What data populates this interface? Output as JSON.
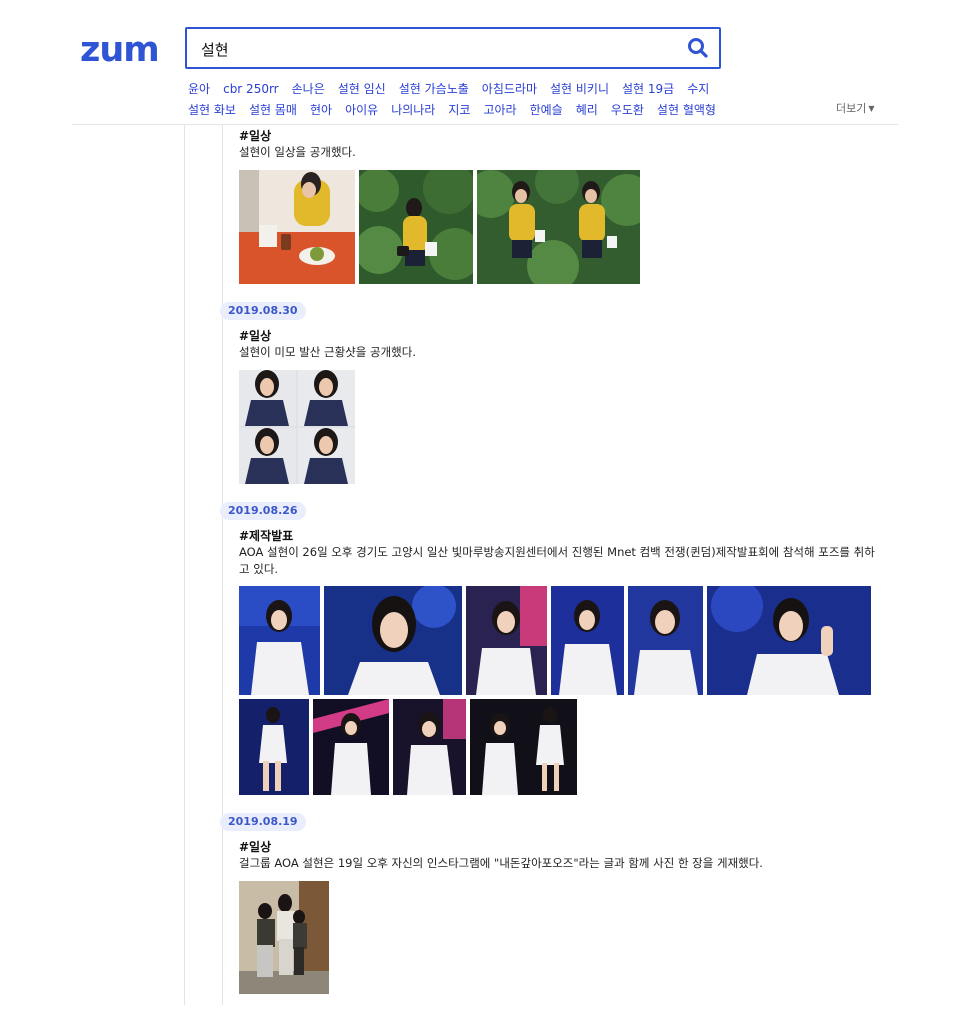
{
  "header": {
    "logo_text": "ZUM",
    "search": {
      "value": "설현"
    },
    "related_row1": [
      "윤아",
      "cbr 250rr",
      "손나은",
      "설현 임신",
      "설현 가슴노출",
      "아침드라마",
      "설현 비키니",
      "설현 19금",
      "수지"
    ],
    "related_row2": [
      "설현 화보",
      "설현 몸매",
      "현아",
      "아이유",
      "나의나라",
      "지코",
      "고아라",
      "한예슬",
      "혜리",
      "우도환",
      "설현 혈액형"
    ],
    "more_label": "더보기"
  },
  "colors": {
    "brand": "#2f55d4",
    "link": "#2a3fd4",
    "badge_bg": "#eaedfb",
    "badge_text": "#3b57c9"
  },
  "timeline": [
    {
      "date": "",
      "tag": "#일상",
      "text": "설현이 일상을 공개했다.",
      "photos": 3
    },
    {
      "date": "2019.08.30",
      "tag": "#일상",
      "text": "설현이 미모 발산 근황샷을 공개했다.",
      "photos": 1
    },
    {
      "date": "2019.08.26",
      "tag": "#제작발표",
      "text": "AOA 설현이 26일 오후 경기도 고양시 일산 빛마루방송지원센터에서 진행된 Mnet 컴백 전쟁(퀸덤)제작발표회에 참석해 포즈를 취하고 있다.",
      "photos": 10
    },
    {
      "date": "2019.08.19",
      "tag": "#일상",
      "text": "걸그룹 AOA 설현은 19일 오후 자신의 인스타그램에 \"내돈갚아포오즈\"라는 글과 함께 사진 한 장을 게재했다.",
      "photos": 1
    }
  ]
}
